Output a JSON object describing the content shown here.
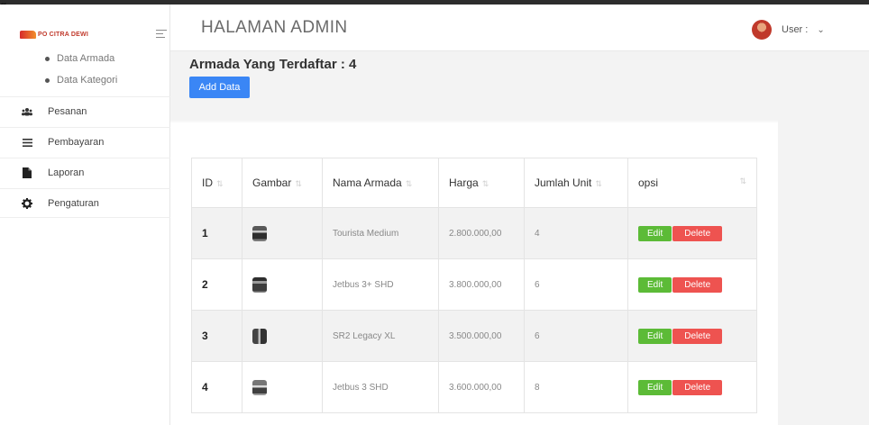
{
  "fragment": {
    "lead": "g"
  },
  "brand": {
    "logo_text": "PO CITRA DEWI"
  },
  "sidebar": {
    "sub_items": [
      {
        "label": "Data Armada"
      },
      {
        "label": "Data Kategori"
      }
    ],
    "items": [
      {
        "label": "Pesanan",
        "icon": "users-icon"
      },
      {
        "label": "Pembayaran",
        "icon": "list-icon"
      },
      {
        "label": "Laporan",
        "icon": "file-icon"
      },
      {
        "label": "Pengaturan",
        "icon": "gear-icon"
      }
    ]
  },
  "header": {
    "title": "HALAMAN ADMIN",
    "user_label": "User :",
    "chevron": "⌄"
  },
  "main": {
    "heading": "Armada Yang Terdaftar : 4",
    "add_button": "Add Data",
    "table": {
      "columns": [
        "ID",
        "Gambar",
        "Nama Armada",
        "Harga",
        "Jumlah Unit",
        "opsi"
      ],
      "rows": [
        {
          "id": "1",
          "nama": "Tourista Medium",
          "harga": "2.800.000,00",
          "jumlah": "4"
        },
        {
          "id": "2",
          "nama": "Jetbus 3+ SHD",
          "harga": "3.800.000,00",
          "jumlah": "6"
        },
        {
          "id": "3",
          "nama": "SR2 Legacy XL",
          "harga": "3.500.000,00",
          "jumlah": "6"
        },
        {
          "id": "4",
          "nama": "Jetbus 3 SHD",
          "harga": "3.600.000,00",
          "jumlah": "8"
        }
      ],
      "edit_label": "Edit",
      "delete_label": "Delete"
    }
  },
  "colors": {
    "primary": "#3a86f5",
    "edit": "#5cbb37",
    "delete": "#ee5350"
  }
}
